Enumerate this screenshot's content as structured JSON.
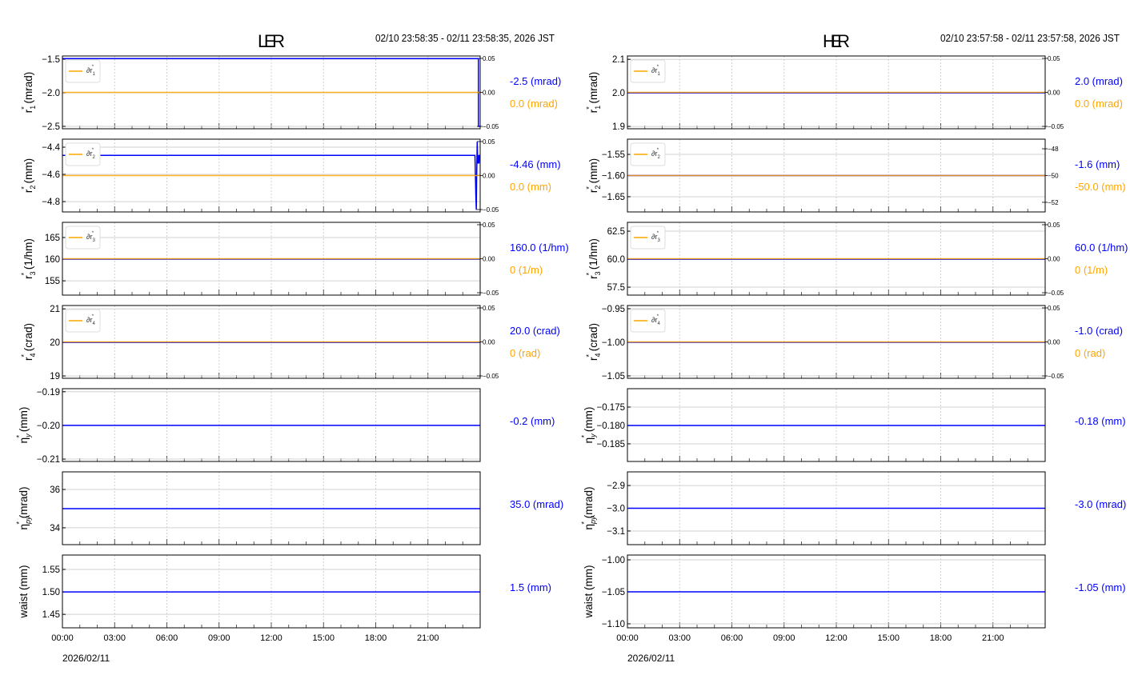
{
  "colors": {
    "blue": "#0000ff",
    "orange": "#ffa500",
    "grid": "#d0d0d0"
  },
  "chart_data": [
    {
      "type": "line",
      "title": "LER",
      "time_range": "02/10 23:58:35 - 02/11 23:58:35, 2026 JST",
      "date_label": "2026/02/11",
      "xlim": [
        0,
        24
      ],
      "x_ticks": [
        0,
        3,
        6,
        9,
        12,
        15,
        18,
        21
      ],
      "x_tick_labels": [
        "00:00",
        "03:00",
        "06:00",
        "09:00",
        "12:00",
        "15:00",
        "18:00",
        "21:00"
      ],
      "panels": [
        {
          "ylabel": {
            "main": "r",
            "sub": "1",
            "sup": "*",
            "unit": " (mrad)"
          },
          "ylim": [
            -2.536,
            -1.452
          ],
          "yticks": [
            -2.5,
            -2.0,
            -1.5
          ],
          "ytick_labels": [
            "−2.5",
            "−2.0",
            "−1.5"
          ],
          "right_ylim": [
            -0.0535,
            0.0535
          ],
          "right_ticks": [
            -0.05,
            0,
            0.05
          ],
          "right_tick_labels": [
            "−0.05",
            "0.00",
            "0.05"
          ],
          "legend": {
            "main": "∂r",
            "sub": "1",
            "sup": "*"
          },
          "blue": [
            [
              0,
              -1.49
            ],
            [
              23.9,
              -1.49
            ],
            [
              23.9,
              -2.5
            ],
            [
              24,
              -2.5
            ]
          ],
          "orange": [
            [
              0,
              0
            ],
            [
              24,
              0
            ]
          ],
          "value_blue": "-2.5 (mrad)",
          "value_orange": "0.0 (mrad)"
        },
        {
          "ylabel": {
            "main": "r",
            "sub": "2",
            "sup": "*",
            "unit": " (mm)"
          },
          "ylim": [
            -4.876,
            -4.341
          ],
          "yticks": [
            -4.8,
            -4.6,
            -4.4
          ],
          "ytick_labels": [
            "−4.8",
            "−4.6",
            "−4.4"
          ],
          "right_ylim": [
            -0.0535,
            0.0535
          ],
          "right_ticks": [
            -0.05,
            0,
            0.05
          ],
          "right_tick_labels": [
            "−0.05",
            "0.00",
            "0.05"
          ],
          "legend": {
            "main": "∂r",
            "sub": "2",
            "sup": "*"
          },
          "blue": [
            [
              0,
              -4.46
            ],
            [
              23.7,
              -4.46
            ],
            [
              23.72,
              -4.56
            ],
            [
              23.75,
              -4.76
            ],
            [
              23.78,
              -4.86
            ],
            [
              23.8,
              -4.62
            ],
            [
              23.83,
              -4.36
            ],
            [
              23.86,
              -4.52
            ],
            [
              23.9,
              -4.46
            ],
            [
              23.93,
              -4.52
            ],
            [
              23.95,
              -4.46
            ],
            [
              24,
              -4.46
            ]
          ],
          "orange": [
            [
              0,
              0
            ],
            [
              24,
              0
            ]
          ],
          "value_blue": "-4.46 (mm)",
          "value_orange": "0.0 (mm)"
        },
        {
          "ylabel": {
            "main": "r",
            "sub": "3",
            "sup": "*",
            "unit": " (1/hm)"
          },
          "ylim": [
            151.7,
            168.5
          ],
          "yticks": [
            155,
            160,
            165
          ],
          "ytick_labels": [
            "155",
            "160",
            "165"
          ],
          "right_ylim": [
            -0.0535,
            0.0535
          ],
          "right_ticks": [
            -0.05,
            0,
            0.05
          ],
          "right_tick_labels": [
            "−0.05",
            "0.00",
            "0.05"
          ],
          "legend": {
            "main": "∂r",
            "sub": "3",
            "sup": "*"
          },
          "blue": [
            [
              0,
              160
            ],
            [
              24,
              160
            ]
          ],
          "orange": [
            [
              0,
              0
            ],
            [
              24,
              0
            ]
          ],
          "value_blue": "160.0 (1/hm)",
          "value_orange": "0 (1/m)"
        },
        {
          "ylabel": {
            "main": "r",
            "sub": "4",
            "sup": "*",
            "unit": " (crad)"
          },
          "ylim": [
            18.93,
            21.1
          ],
          "yticks": [
            19,
            20,
            21
          ],
          "ytick_labels": [
            "19",
            "20",
            "21"
          ],
          "right_ylim": [
            -0.0535,
            0.0535
          ],
          "right_ticks": [
            -0.05,
            0,
            0.05
          ],
          "right_tick_labels": [
            "−0.05",
            "0.00",
            "0.05"
          ],
          "legend": {
            "main": "∂r",
            "sub": "4",
            "sup": "*"
          },
          "blue": [
            [
              0,
              20
            ],
            [
              24,
              20
            ]
          ],
          "orange": [
            [
              0,
              0
            ],
            [
              24,
              0
            ]
          ],
          "value_blue": "20.0 (crad)",
          "value_orange": "0 (rad)"
        },
        {
          "ylabel": {
            "main": "η",
            "sub": "y",
            "sup": "*",
            "unit": " (mm)"
          },
          "ylim": [
            -0.2107,
            -0.1891
          ],
          "yticks": [
            -0.21,
            -0.2,
            -0.19
          ],
          "ytick_labels": [
            "−0.21",
            "−0.20",
            "−0.19"
          ],
          "blue": [
            [
              0,
              -0.2
            ],
            [
              24,
              -0.2
            ]
          ],
          "value_blue": "-0.2 (mm)"
        },
        {
          "ylabel": {
            "main": "η",
            "sub": "py",
            "sup": "*",
            "unit": " (mrad)"
          },
          "ylim": [
            33.12,
            36.92
          ],
          "yticks": [
            34,
            36
          ],
          "ytick_labels": [
            "34",
            "36"
          ],
          "blue": [
            [
              0,
              35
            ],
            [
              24,
              35
            ]
          ],
          "value_blue": "35.0 (mrad)"
        },
        {
          "ylabel": {
            "main": "waist (mm)",
            "sub": "",
            "sup": "",
            "unit": ""
          },
          "ylim": [
            1.42,
            1.582
          ],
          "yticks": [
            1.45,
            1.5,
            1.55
          ],
          "ytick_labels": [
            "1.45",
            "1.50",
            "1.55"
          ],
          "blue": [
            [
              0,
              1.5
            ],
            [
              24,
              1.5
            ]
          ],
          "value_blue": "1.5 (mm)"
        }
      ]
    },
    {
      "type": "line",
      "title": "HER",
      "time_range": "02/10 23:57:58 - 02/11 23:57:58, 2026 JST",
      "date_label": "2026/02/11",
      "xlim": [
        0,
        24
      ],
      "x_ticks": [
        0,
        3,
        6,
        9,
        12,
        15,
        18,
        21
      ],
      "x_tick_labels": [
        "00:00",
        "03:00",
        "06:00",
        "09:00",
        "12:00",
        "15:00",
        "18:00",
        "21:00"
      ],
      "panels": [
        {
          "ylabel": {
            "main": "r",
            "sub": "1",
            "sup": "*",
            "unit": " (mrad)"
          },
          "ylim": [
            1.893,
            2.11
          ],
          "yticks": [
            1.9,
            2.0,
            2.1
          ],
          "ytick_labels": [
            "1.9",
            "2.0",
            "2.1"
          ],
          "right_ylim": [
            -0.0535,
            0.0535
          ],
          "right_ticks": [
            -0.05,
            0,
            0.05
          ],
          "right_tick_labels": [
            "−0.05",
            "0.00",
            "0.05"
          ],
          "legend": {
            "main": "∂r",
            "sub": "1",
            "sup": "*"
          },
          "blue": [
            [
              0,
              2.0
            ],
            [
              24,
              2.0
            ]
          ],
          "orange": [
            [
              0,
              0
            ],
            [
              24,
              0
            ]
          ],
          "value_blue": "2.0 (mrad)",
          "value_orange": "0.0 (mrad)"
        },
        {
          "ylabel": {
            "main": "r",
            "sub": "2",
            "sup": "*",
            "unit": " (mm)"
          },
          "ylim": [
            -1.686,
            -1.514
          ],
          "yticks": [
            -1.65,
            -1.6,
            -1.55
          ],
          "ytick_labels": [
            "−1.65",
            "−1.60",
            "−1.55"
          ],
          "right_ylim": [
            -52.72,
            -47.28
          ],
          "right_ticks": [
            -52,
            -50,
            -48
          ],
          "right_tick_labels": [
            "−52",
            "−50",
            "−48"
          ],
          "legend": {
            "main": "∂r",
            "sub": "2",
            "sup": "*"
          },
          "blue": [
            [
              0,
              -1.6
            ],
            [
              24,
              -1.6
            ]
          ],
          "orange": [
            [
              0,
              -50
            ],
            [
              24,
              -50
            ]
          ],
          "value_blue": "-1.6 (mm)",
          "value_orange": "-50.0 (mm)"
        },
        {
          "ylabel": {
            "main": "r",
            "sub": "3",
            "sup": "*",
            "unit": " (1/hm)"
          },
          "ylim": [
            56.79,
            63.29
          ],
          "yticks": [
            57.5,
            60.0,
            62.5
          ],
          "ytick_labels": [
            "57.5",
            "60.0",
            "62.5"
          ],
          "right_ylim": [
            -0.0535,
            0.0535
          ],
          "right_ticks": [
            -0.05,
            0,
            0.05
          ],
          "right_tick_labels": [
            "−0.05",
            "0.00",
            "0.05"
          ],
          "legend": {
            "main": "∂r",
            "sub": "3",
            "sup": "*"
          },
          "blue": [
            [
              0,
              60
            ],
            [
              24,
              60
            ]
          ],
          "orange": [
            [
              0,
              0
            ],
            [
              24,
              0
            ]
          ],
          "value_blue": "60.0 (1/hm)",
          "value_orange": "0 (1/m)"
        },
        {
          "ylabel": {
            "main": "r",
            "sub": "4",
            "sup": "*",
            "unit": " (crad)"
          },
          "ylim": [
            -1.0536,
            -0.9452
          ],
          "yticks": [
            -1.05,
            -1.0,
            -0.95
          ],
          "ytick_labels": [
            "−1.05",
            "−1.00",
            "−0.95"
          ],
          "right_ylim": [
            -0.0535,
            0.0535
          ],
          "right_ticks": [
            -0.05,
            0,
            0.05
          ],
          "right_tick_labels": [
            "−0.05",
            "0.00",
            "0.05"
          ],
          "legend": {
            "main": "∂r",
            "sub": "4",
            "sup": "*"
          },
          "blue": [
            [
              0,
              -1.0
            ],
            [
              24,
              -1.0
            ]
          ],
          "orange": [
            [
              0,
              0
            ],
            [
              24,
              0
            ]
          ],
          "value_blue": "-1.0 (crad)",
          "value_orange": "0 (rad)"
        },
        {
          "ylabel": {
            "main": "η",
            "sub": "y",
            "sup": "*",
            "unit": " (mm)"
          },
          "ylim": [
            -0.1898,
            -0.17
          ],
          "yticks": [
            -0.185,
            -0.18,
            -0.175
          ],
          "ytick_labels": [
            "−0.185",
            "−0.180",
            "−0.175"
          ],
          "blue": [
            [
              0,
              -0.18
            ],
            [
              24,
              -0.18
            ]
          ],
          "value_blue": "-0.18 (mm)"
        },
        {
          "ylabel": {
            "main": "η",
            "sub": "py",
            "sup": "*",
            "unit": " (mrad)"
          },
          "ylim": [
            -3.16,
            -2.84
          ],
          "yticks": [
            -3.1,
            -3.0,
            -2.9
          ],
          "ytick_labels": [
            "−3.1",
            "−3.0",
            "−2.9"
          ],
          "blue": [
            [
              0,
              -3.0
            ],
            [
              24,
              -3.0
            ]
          ],
          "value_blue": "-3.0 (mrad)"
        },
        {
          "ylabel": {
            "main": "waist (mm)",
            "sub": "",
            "sup": "",
            "unit": ""
          },
          "ylim": [
            -1.1063,
            -0.9925
          ],
          "yticks": [
            -1.1,
            -1.05,
            -1.0
          ],
          "ytick_labels": [
            "−1.10",
            "−1.05",
            "−1.00"
          ],
          "blue": [
            [
              0,
              -1.05
            ],
            [
              24,
              -1.05
            ]
          ],
          "value_blue": "-1.05 (mm)"
        }
      ]
    }
  ]
}
